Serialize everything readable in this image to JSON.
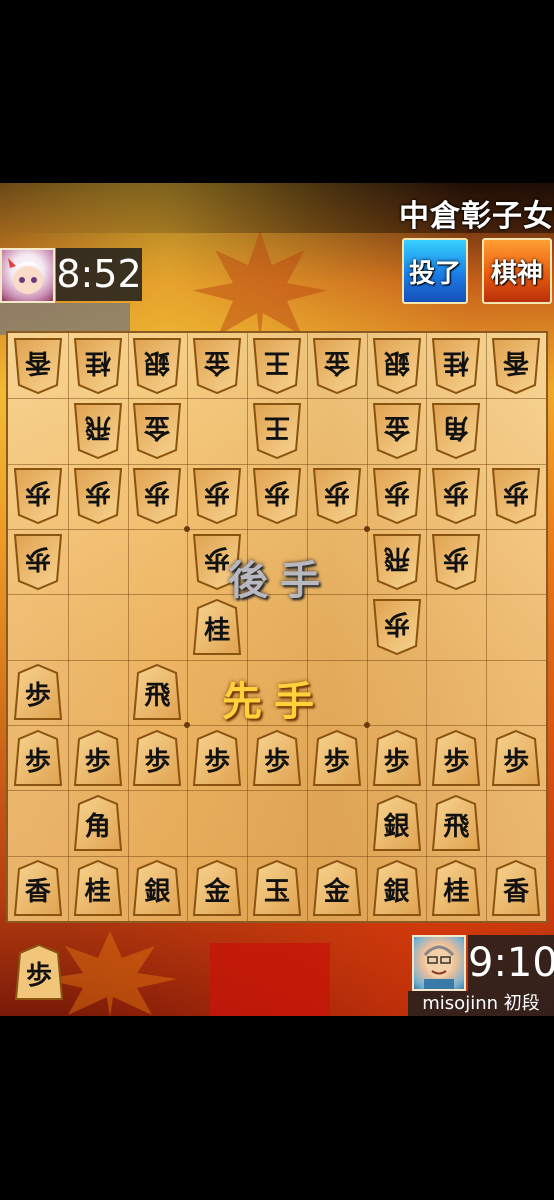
{
  "header": {
    "title": "中倉彰子女"
  },
  "buttons": {
    "tsume": "投了",
    "kishin": "棋神"
  },
  "players": {
    "top": {
      "timer": "8:52"
    },
    "bottom": {
      "timer": "9:10",
      "name": "misojinn 初段"
    }
  },
  "banners": {
    "gote": "後手",
    "sente": "先手"
  },
  "board": {
    "gote_pieces": [
      {
        "c": 0,
        "r": 0,
        "k": "香"
      },
      {
        "c": 1,
        "r": 0,
        "k": "桂"
      },
      {
        "c": 2,
        "r": 0,
        "k": "銀"
      },
      {
        "c": 3,
        "r": 0,
        "k": "金"
      },
      {
        "c": 4,
        "r": 0,
        "k": "王"
      },
      {
        "c": 5,
        "r": 0,
        "k": "金"
      },
      {
        "c": 6,
        "r": 0,
        "k": "銀"
      },
      {
        "c": 7,
        "r": 0,
        "k": "桂"
      },
      {
        "c": 8,
        "r": 0,
        "k": "香"
      },
      {
        "c": 1,
        "r": 1,
        "k": "飛"
      },
      {
        "c": 2,
        "r": 1,
        "k": "金"
      },
      {
        "c": 4,
        "r": 1,
        "k": "王"
      },
      {
        "c": 6,
        "r": 1,
        "k": "金"
      },
      {
        "c": 7,
        "r": 1,
        "k": "角"
      },
      {
        "c": 0,
        "r": 2,
        "k": "歩"
      },
      {
        "c": 1,
        "r": 2,
        "k": "歩"
      },
      {
        "c": 2,
        "r": 2,
        "k": "歩"
      },
      {
        "c": 3,
        "r": 2,
        "k": "歩"
      },
      {
        "c": 4,
        "r": 2,
        "k": "歩"
      },
      {
        "c": 5,
        "r": 2,
        "k": "歩"
      },
      {
        "c": 6,
        "r": 2,
        "k": "歩"
      },
      {
        "c": 7,
        "r": 2,
        "k": "歩"
      },
      {
        "c": 8,
        "r": 2,
        "k": "歩"
      },
      {
        "c": 0,
        "r": 3,
        "k": "歩"
      },
      {
        "c": 3,
        "r": 3,
        "k": "歩"
      },
      {
        "c": 6,
        "r": 3,
        "k": "飛"
      },
      {
        "c": 7,
        "r": 3,
        "k": "歩"
      },
      {
        "c": 6,
        "r": 4,
        "k": "歩"
      }
    ],
    "sente_pieces": [
      {
        "c": 3,
        "r": 4,
        "k": "桂"
      },
      {
        "c": 0,
        "r": 5,
        "k": "歩"
      },
      {
        "c": 2,
        "r": 5,
        "k": "飛"
      },
      {
        "c": 0,
        "r": 6,
        "k": "歩"
      },
      {
        "c": 1,
        "r": 6,
        "k": "歩"
      },
      {
        "c": 2,
        "r": 6,
        "k": "歩"
      },
      {
        "c": 3,
        "r": 6,
        "k": "歩"
      },
      {
        "c": 4,
        "r": 6,
        "k": "歩"
      },
      {
        "c": 5,
        "r": 6,
        "k": "歩"
      },
      {
        "c": 6,
        "r": 6,
        "k": "歩"
      },
      {
        "c": 7,
        "r": 6,
        "k": "歩"
      },
      {
        "c": 8,
        "r": 6,
        "k": "歩"
      },
      {
        "c": 1,
        "r": 7,
        "k": "角"
      },
      {
        "c": 6,
        "r": 7,
        "k": "銀"
      },
      {
        "c": 7,
        "r": 7,
        "k": "飛"
      },
      {
        "c": 0,
        "r": 8,
        "k": "香"
      },
      {
        "c": 1,
        "r": 8,
        "k": "桂"
      },
      {
        "c": 2,
        "r": 8,
        "k": "銀"
      },
      {
        "c": 3,
        "r": 8,
        "k": "金"
      },
      {
        "c": 4,
        "r": 8,
        "k": "玉"
      },
      {
        "c": 5,
        "r": 8,
        "k": "金"
      },
      {
        "c": 6,
        "r": 8,
        "k": "銀"
      },
      {
        "c": 7,
        "r": 8,
        "k": "桂"
      },
      {
        "c": 8,
        "r": 8,
        "k": "香"
      }
    ]
  },
  "hand": {
    "sente_piece": "歩"
  }
}
